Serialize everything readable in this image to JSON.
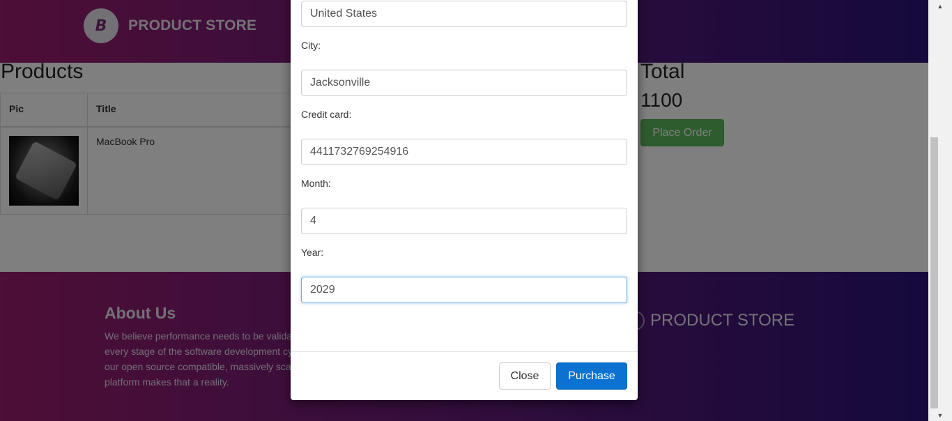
{
  "header": {
    "brand_logo_letter": "B",
    "brand_name": "PRODUCT STORE"
  },
  "products": {
    "title": "Products",
    "columns": [
      "Pic",
      "Title"
    ],
    "rows": [
      {
        "title": "MacBook Pro"
      }
    ]
  },
  "total": {
    "title": "Total",
    "value": "1100",
    "place_order_label": "Place Order"
  },
  "footer": {
    "about_title": "About Us",
    "about_text": "We believe performance needs to be validated at every stage of the software development cycle and our open source compatible, massively scalable platform makes that a reality.",
    "brand_name": "PRODUCT STORE"
  },
  "modal": {
    "country_value": "United States",
    "city_label": "City:",
    "city_value": "Jacksonville",
    "card_label": "Credit card:",
    "card_value": "4411732769254916",
    "month_label": "Month:",
    "month_value": "4",
    "year_label": "Year:",
    "year_value": "2029",
    "close_label": "Close",
    "purchase_label": "Purchase"
  },
  "colors": {
    "gradient_start": "#9a1d6e",
    "gradient_end": "#2b1478",
    "place_order": "#5cb85c",
    "purchase": "#0b72d2"
  }
}
